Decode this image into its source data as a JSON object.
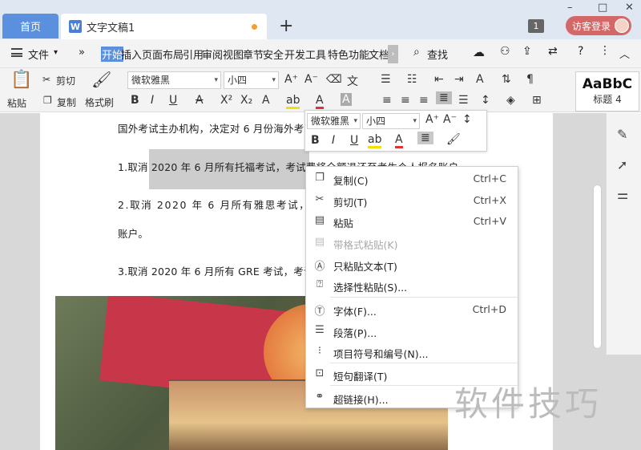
{
  "tabs": {
    "home": "首页",
    "doc_icon": "W",
    "doc_title": "文字文稿1",
    "add": "+"
  },
  "titlebar": {
    "badge": "1",
    "login": "访客登录",
    "win_min": "–",
    "win_max": "□",
    "win_close": "✕"
  },
  "menu": {
    "file": "文件",
    "more_left": "»",
    "items": [
      "开始",
      "插入",
      "页面布局",
      "引用",
      "审阅",
      "视图",
      "章节",
      "安全",
      "开发工具",
      "特色功能",
      "文档"
    ],
    "more_right": "›",
    "search": "查找"
  },
  "ribbon": {
    "paste": "粘贴",
    "cut": "剪切",
    "copy": "复制",
    "format_painter": "格式刷",
    "font": "微软雅黑",
    "size": "小四",
    "style_preview": "AaBbC",
    "style_name": "标题 4"
  },
  "document": {
    "line1": "国外考试主办机构，决定对 6 月份海外考",
    "line2": "1.取消 2020 年 6 月所有托福考试，考试费将全额退还至考生个人报名账户",
    "line3": "2.取消 2020 年 6 月所有雅思考试，",
    "line4": "账户。",
    "line5": "3.取消 2020 年 6 月所有 GRE 考试，考试"
  },
  "mini_toolbar": {
    "font": "微软雅黑",
    "size": "小四"
  },
  "context_menu": {
    "items": [
      {
        "icon": "copy-icon",
        "label": "复制(C)",
        "shortcut": "Ctrl+C",
        "disabled": false
      },
      {
        "icon": "scissors-icon",
        "label": "剪切(T)",
        "shortcut": "Ctrl+X",
        "disabled": false
      },
      {
        "icon": "paste-icon",
        "label": "粘贴",
        "shortcut": "Ctrl+V",
        "disabled": false
      },
      {
        "icon": "paste-format-icon",
        "label": "带格式粘贴(K)",
        "shortcut": "",
        "disabled": true
      },
      {
        "icon": "paste-text-icon",
        "label": "只粘贴文本(T)",
        "shortcut": "",
        "disabled": false
      },
      {
        "icon": "paste-special-icon",
        "label": "选择性粘贴(S)...",
        "shortcut": "",
        "disabled": false
      },
      {
        "icon": "font-icon",
        "label": "字体(F)...",
        "shortcut": "Ctrl+D",
        "disabled": false
      },
      {
        "icon": "paragraph-icon",
        "label": "段落(P)...",
        "shortcut": "",
        "disabled": false
      },
      {
        "icon": "bullets-icon",
        "label": "项目符号和编号(N)...",
        "shortcut": "",
        "disabled": false
      },
      {
        "icon": "translate-icon",
        "label": "短句翻译(T)",
        "shortcut": "",
        "disabled": false
      },
      {
        "icon": "link-icon",
        "label": "超链接(H)...",
        "shortcut": "",
        "disabled": false
      }
    ]
  },
  "watermark": "软件技巧"
}
